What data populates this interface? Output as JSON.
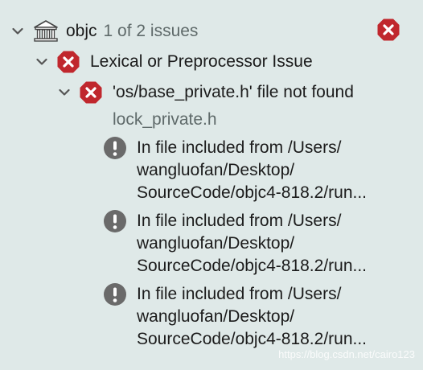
{
  "root": {
    "name": "objc",
    "summary": "1 of 2 issues",
    "icon": "building-columns-icon"
  },
  "group": {
    "label": "Lexical or Preprocessor Issue"
  },
  "error": {
    "message": "'os/base_private.h' file not found",
    "file": "lock_private.h"
  },
  "notes": [
    {
      "lines": [
        "In file included from /Users/",
        "wangluofan/Desktop/",
        "SourceCode/objc4-818.2/run..."
      ]
    },
    {
      "lines": [
        "In file included from /Users/",
        "wangluofan/Desktop/",
        "SourceCode/objc4-818.2/run..."
      ]
    },
    {
      "lines": [
        "In file included from /Users/",
        "wangluofan/Desktop/",
        "SourceCode/objc4-818.2/run..."
      ]
    }
  ],
  "watermark": "https://blog.csdn.net/cairo123",
  "colors": {
    "background": "#dfe9e8",
    "error_red": "#c0272d",
    "warning_gray": "#6a6a6a"
  }
}
